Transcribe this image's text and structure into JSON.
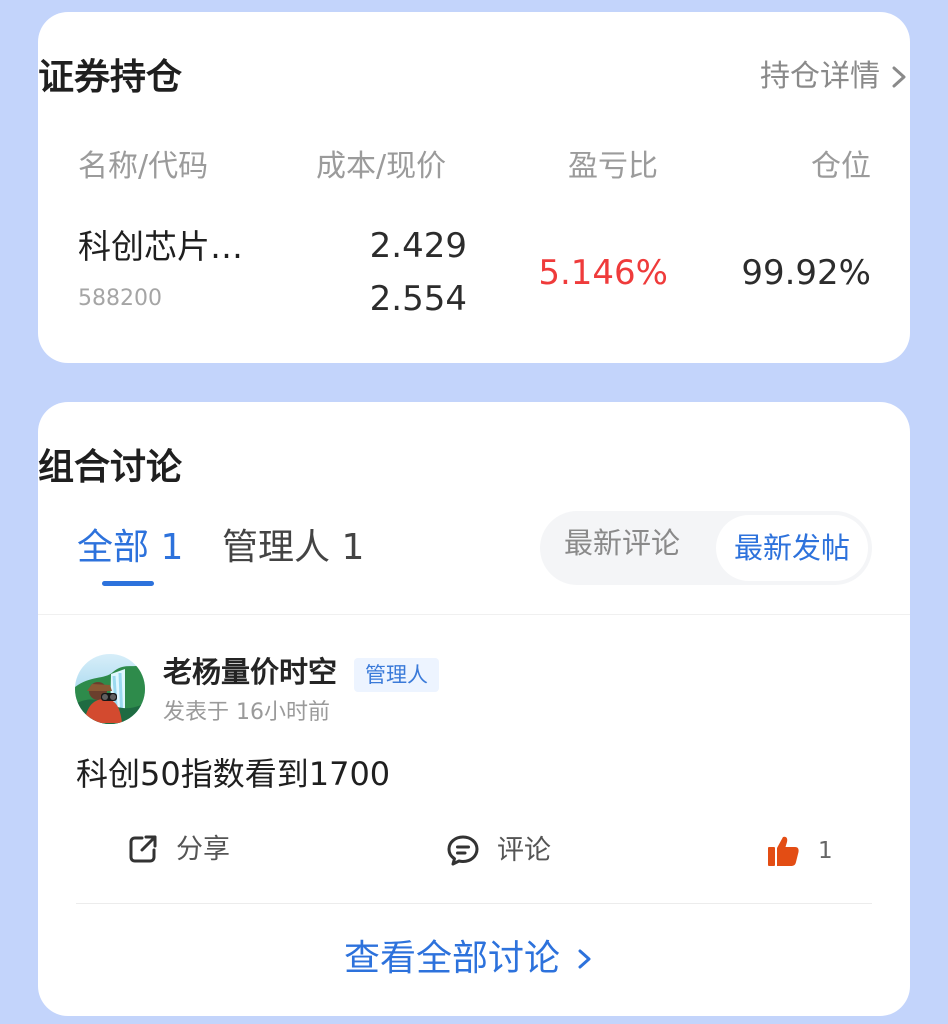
{
  "holdings": {
    "title": "证券持仓",
    "detail_label": "持仓详情",
    "columns": {
      "name": "名称/代码",
      "cost_price": "成本/现价",
      "profit_ratio": "盈亏比",
      "position": "仓位"
    },
    "rows": [
      {
        "name": "科创芯片…",
        "code": "588200",
        "cost": "2.429",
        "price": "2.554",
        "profit_ratio": "5.146%",
        "position": "99.92%"
      }
    ]
  },
  "discussion": {
    "title": "组合讨论",
    "tabs": [
      {
        "label": "全部 1"
      },
      {
        "label": "管理人 1"
      }
    ],
    "sort_options": [
      {
        "label": "最新评论"
      },
      {
        "label": "最新发帖"
      }
    ],
    "post": {
      "author": "老杨量价时空",
      "badge": "管理人",
      "time": "发表于 16小时前",
      "content": "科创50指数看到1700",
      "actions": {
        "share": "分享",
        "comment": "评论",
        "like_count": "1"
      }
    },
    "view_all_label": "查看全部讨论"
  },
  "colors": {
    "page_background": "#c3d4fb",
    "card_background": "#ffffff",
    "accent": "#2d72dc",
    "positive_red": "#ef3b3b",
    "like_orange": "#e34d14"
  },
  "icons": {
    "detail_chevron": "chevron-right-icon",
    "share": "share-icon",
    "comment": "comment-icon",
    "like": "thumbs-up-icon",
    "view_all_chevron": "chevron-right-icon"
  }
}
